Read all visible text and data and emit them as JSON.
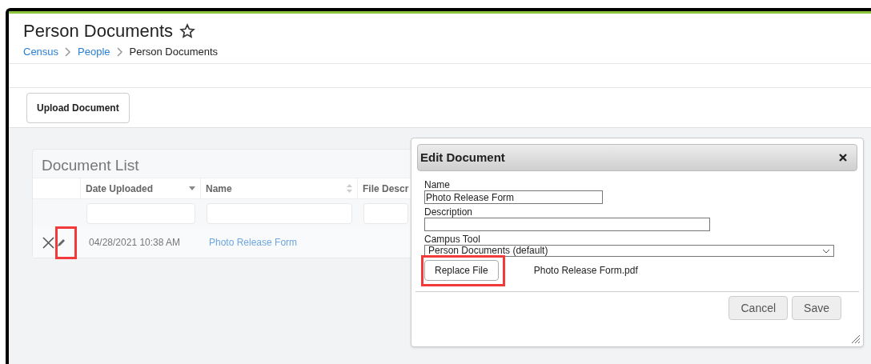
{
  "header": {
    "title": "Person Documents",
    "breadcrumbs": [
      {
        "label": "Census",
        "link": true
      },
      {
        "label": "People",
        "link": true
      },
      {
        "label": "Person Documents",
        "link": false
      }
    ]
  },
  "toolbar": {
    "buttons": [
      "Upload Document"
    ]
  },
  "document_list": {
    "title": "Document List",
    "columns": [
      {
        "label": "Date Uploaded",
        "kind": "sorted"
      },
      {
        "label": "Name",
        "kind": "sortable"
      },
      {
        "label": "File Descr",
        "kind": "plain"
      }
    ],
    "rows": [
      {
        "date": "04/28/2021 10:38 AM",
        "name": "Photo Release Form",
        "highlight_edit": true
      }
    ]
  },
  "dialog": {
    "title": "Edit Document",
    "fields": [
      {
        "label": "Name",
        "kind": "text",
        "value": "Photo Release Form"
      },
      {
        "label": "Description",
        "kind": "text"
      },
      {
        "label": "Campus Tool",
        "kind": "select",
        "value": "Person Documents (default)"
      }
    ],
    "replace_button": "Replace File",
    "replace_highlight": true,
    "file_name": "Photo Release Form.pdf",
    "buttons": [
      "Cancel",
      "Save"
    ]
  }
}
